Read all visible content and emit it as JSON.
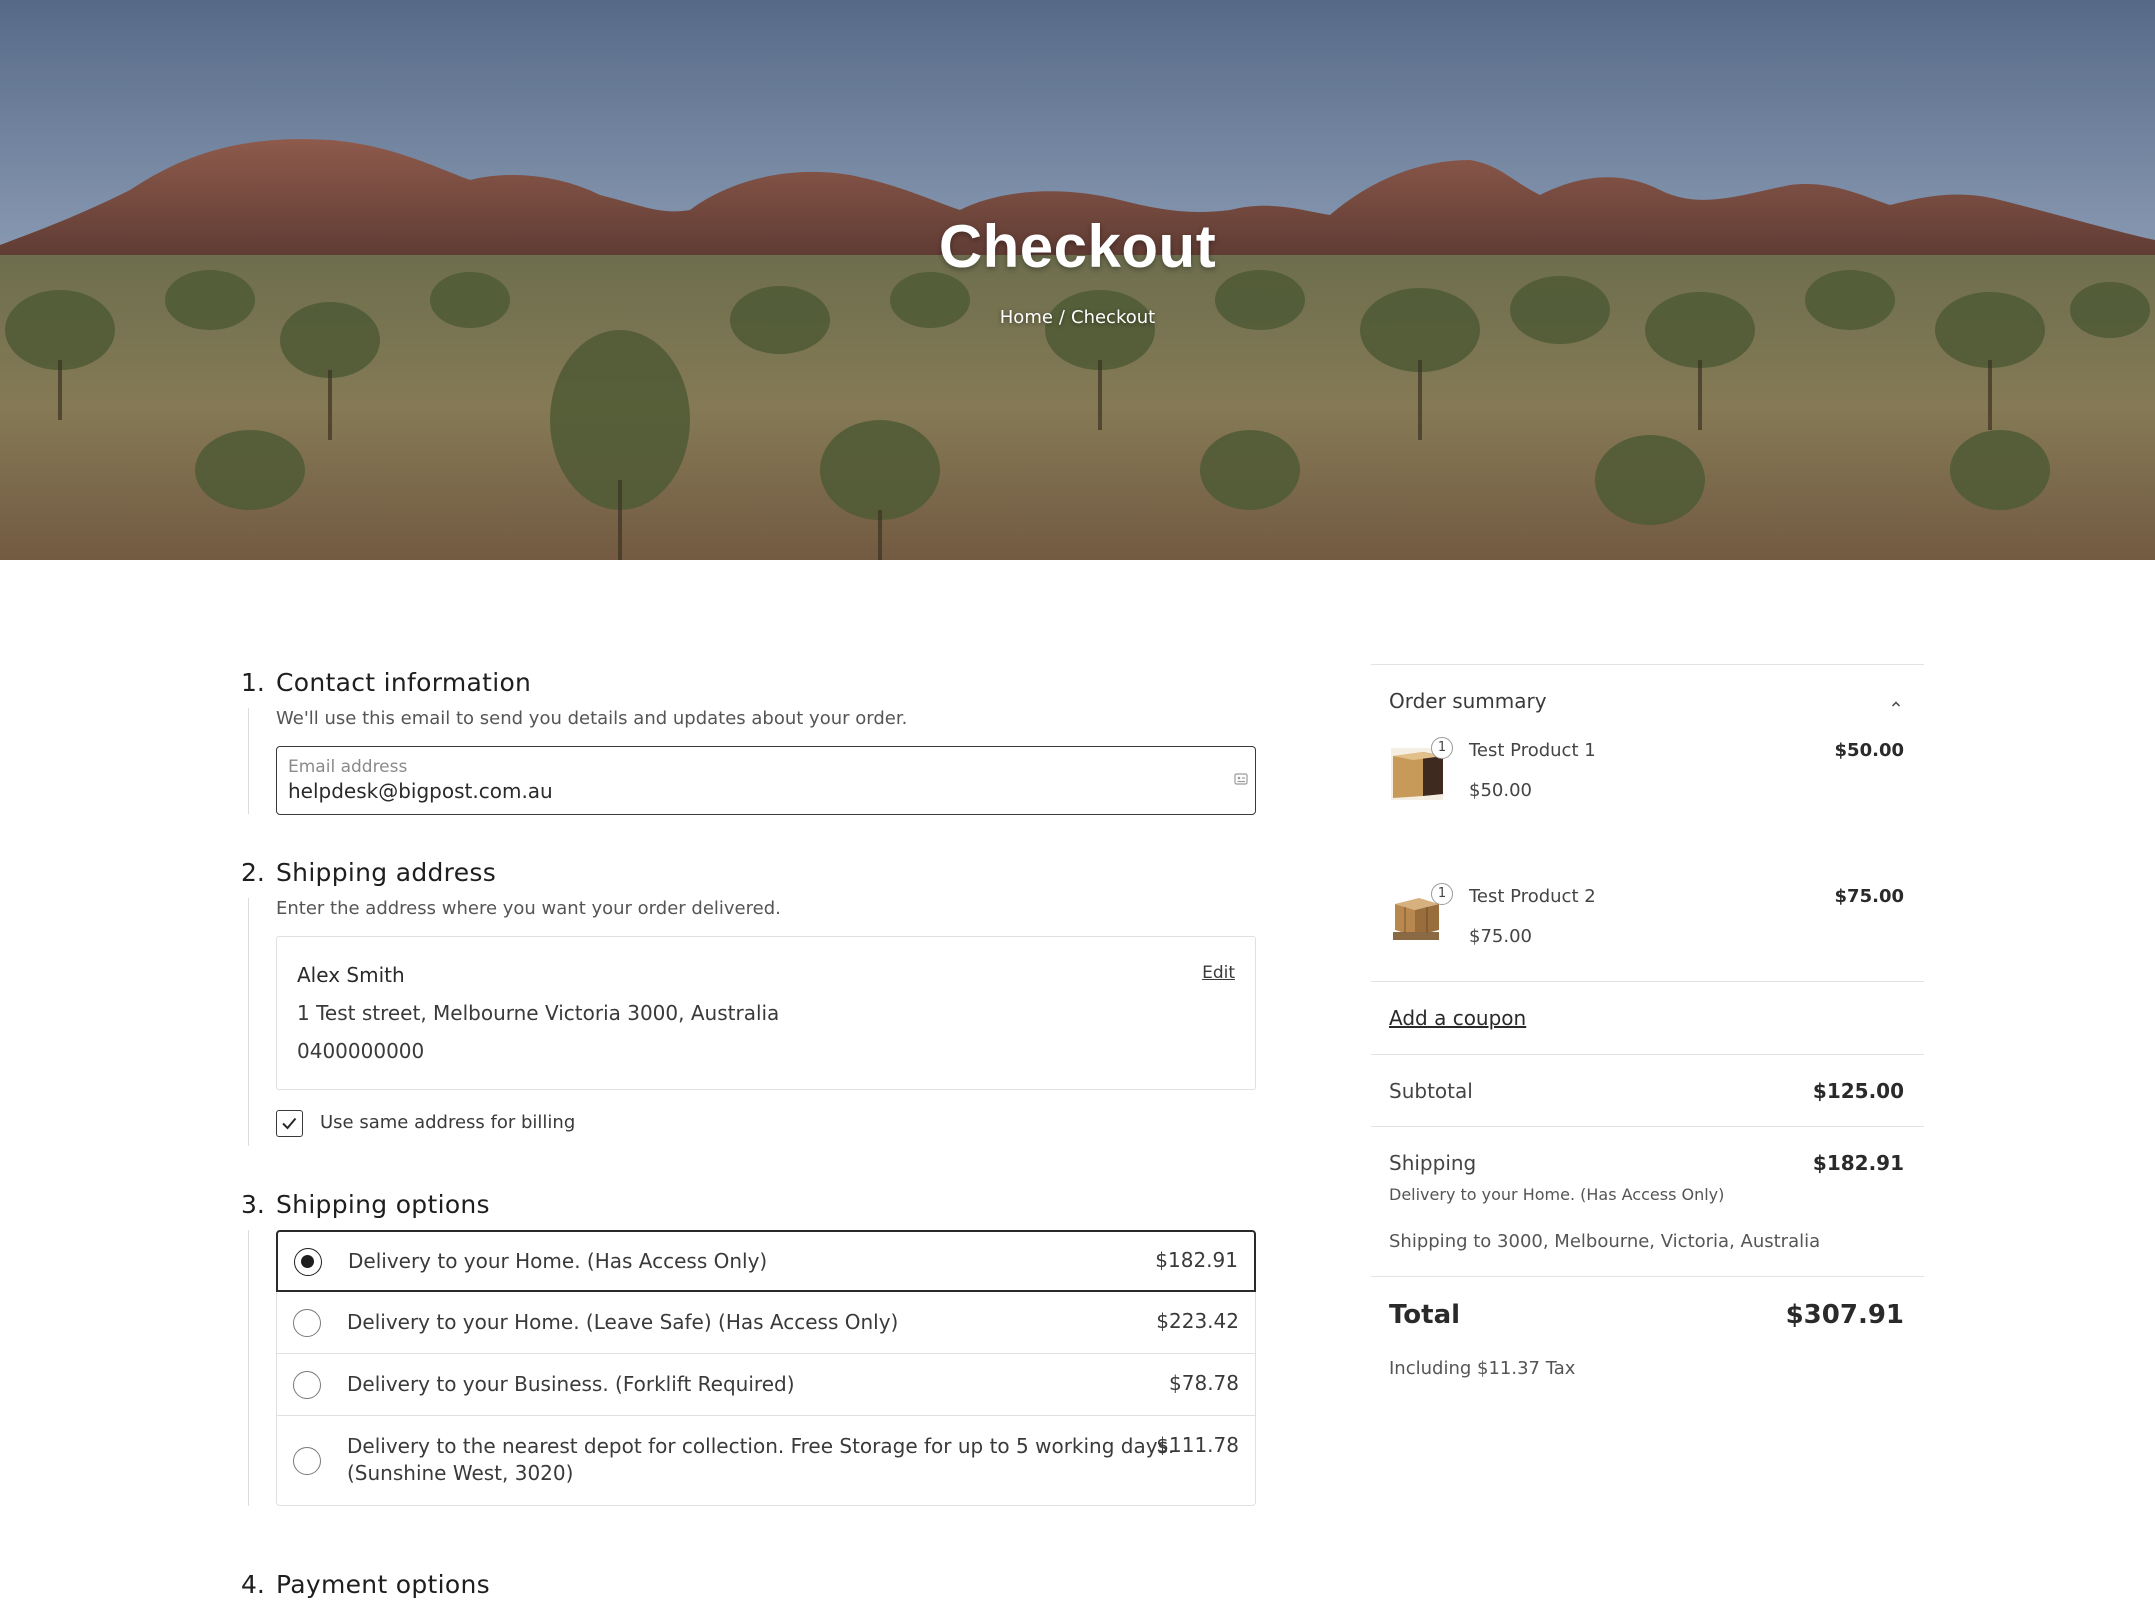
{
  "hero": {
    "title": "Checkout",
    "breadcrumb": {
      "home": "Home",
      "separator": "/",
      "current": "Checkout"
    }
  },
  "contact": {
    "number": "1.",
    "title": "Contact information",
    "description": "We'll use this email to send you details and updates about your order.",
    "email_label": "Email address",
    "email_value": "helpdesk@bigpost.com.au"
  },
  "shipping_address": {
    "number": "2.",
    "title": "Shipping address",
    "description": "Enter the address where you want your order delivered.",
    "name": "Alex Smith",
    "address": "1 Test street, Melbourne Victoria 3000, Australia",
    "phone": "0400000000",
    "edit_label": "Edit",
    "billing_checkbox_label": "Use same address for billing",
    "billing_checked": true
  },
  "shipping_options": {
    "number": "3.",
    "title": "Shipping options",
    "options": [
      {
        "label": "Delivery to your Home. (Has Access Only)",
        "price": "$182.91",
        "selected": true
      },
      {
        "label": "Delivery to your Home. (Leave Safe) (Has Access Only)",
        "price": "$223.42",
        "selected": false
      },
      {
        "label": "Delivery to your Business. (Forklift Required)",
        "price": "$78.78",
        "selected": false
      },
      {
        "label_line1": "Delivery to the nearest depot for collection. Free Storage for up to 5 working days.",
        "label_line2": "(Sunshine West, 3020)",
        "price": "$111.78",
        "selected": false
      }
    ]
  },
  "payment": {
    "number": "4.",
    "title": "Payment options"
  },
  "summary": {
    "title": "Order summary",
    "items": [
      {
        "name": "Test Product 1",
        "unit_price": "$50.00",
        "line_total": "$50.00",
        "qty": "1"
      },
      {
        "name": "Test Product 2",
        "unit_price": "$75.00",
        "line_total": "$75.00",
        "qty": "1"
      }
    ],
    "coupon_label": "Add a coupon",
    "subtotal_label": "Subtotal",
    "subtotal_value": "$125.00",
    "shipping_label": "Shipping",
    "shipping_value": "$182.91",
    "shipping_method": "Delivery to your Home. (Has Access Only)",
    "shipping_destination": "Shipping to 3000, Melbourne, Victoria, Australia",
    "total_label": "Total",
    "total_value": "$307.91",
    "tax_note": "Including $11.37 Tax"
  }
}
